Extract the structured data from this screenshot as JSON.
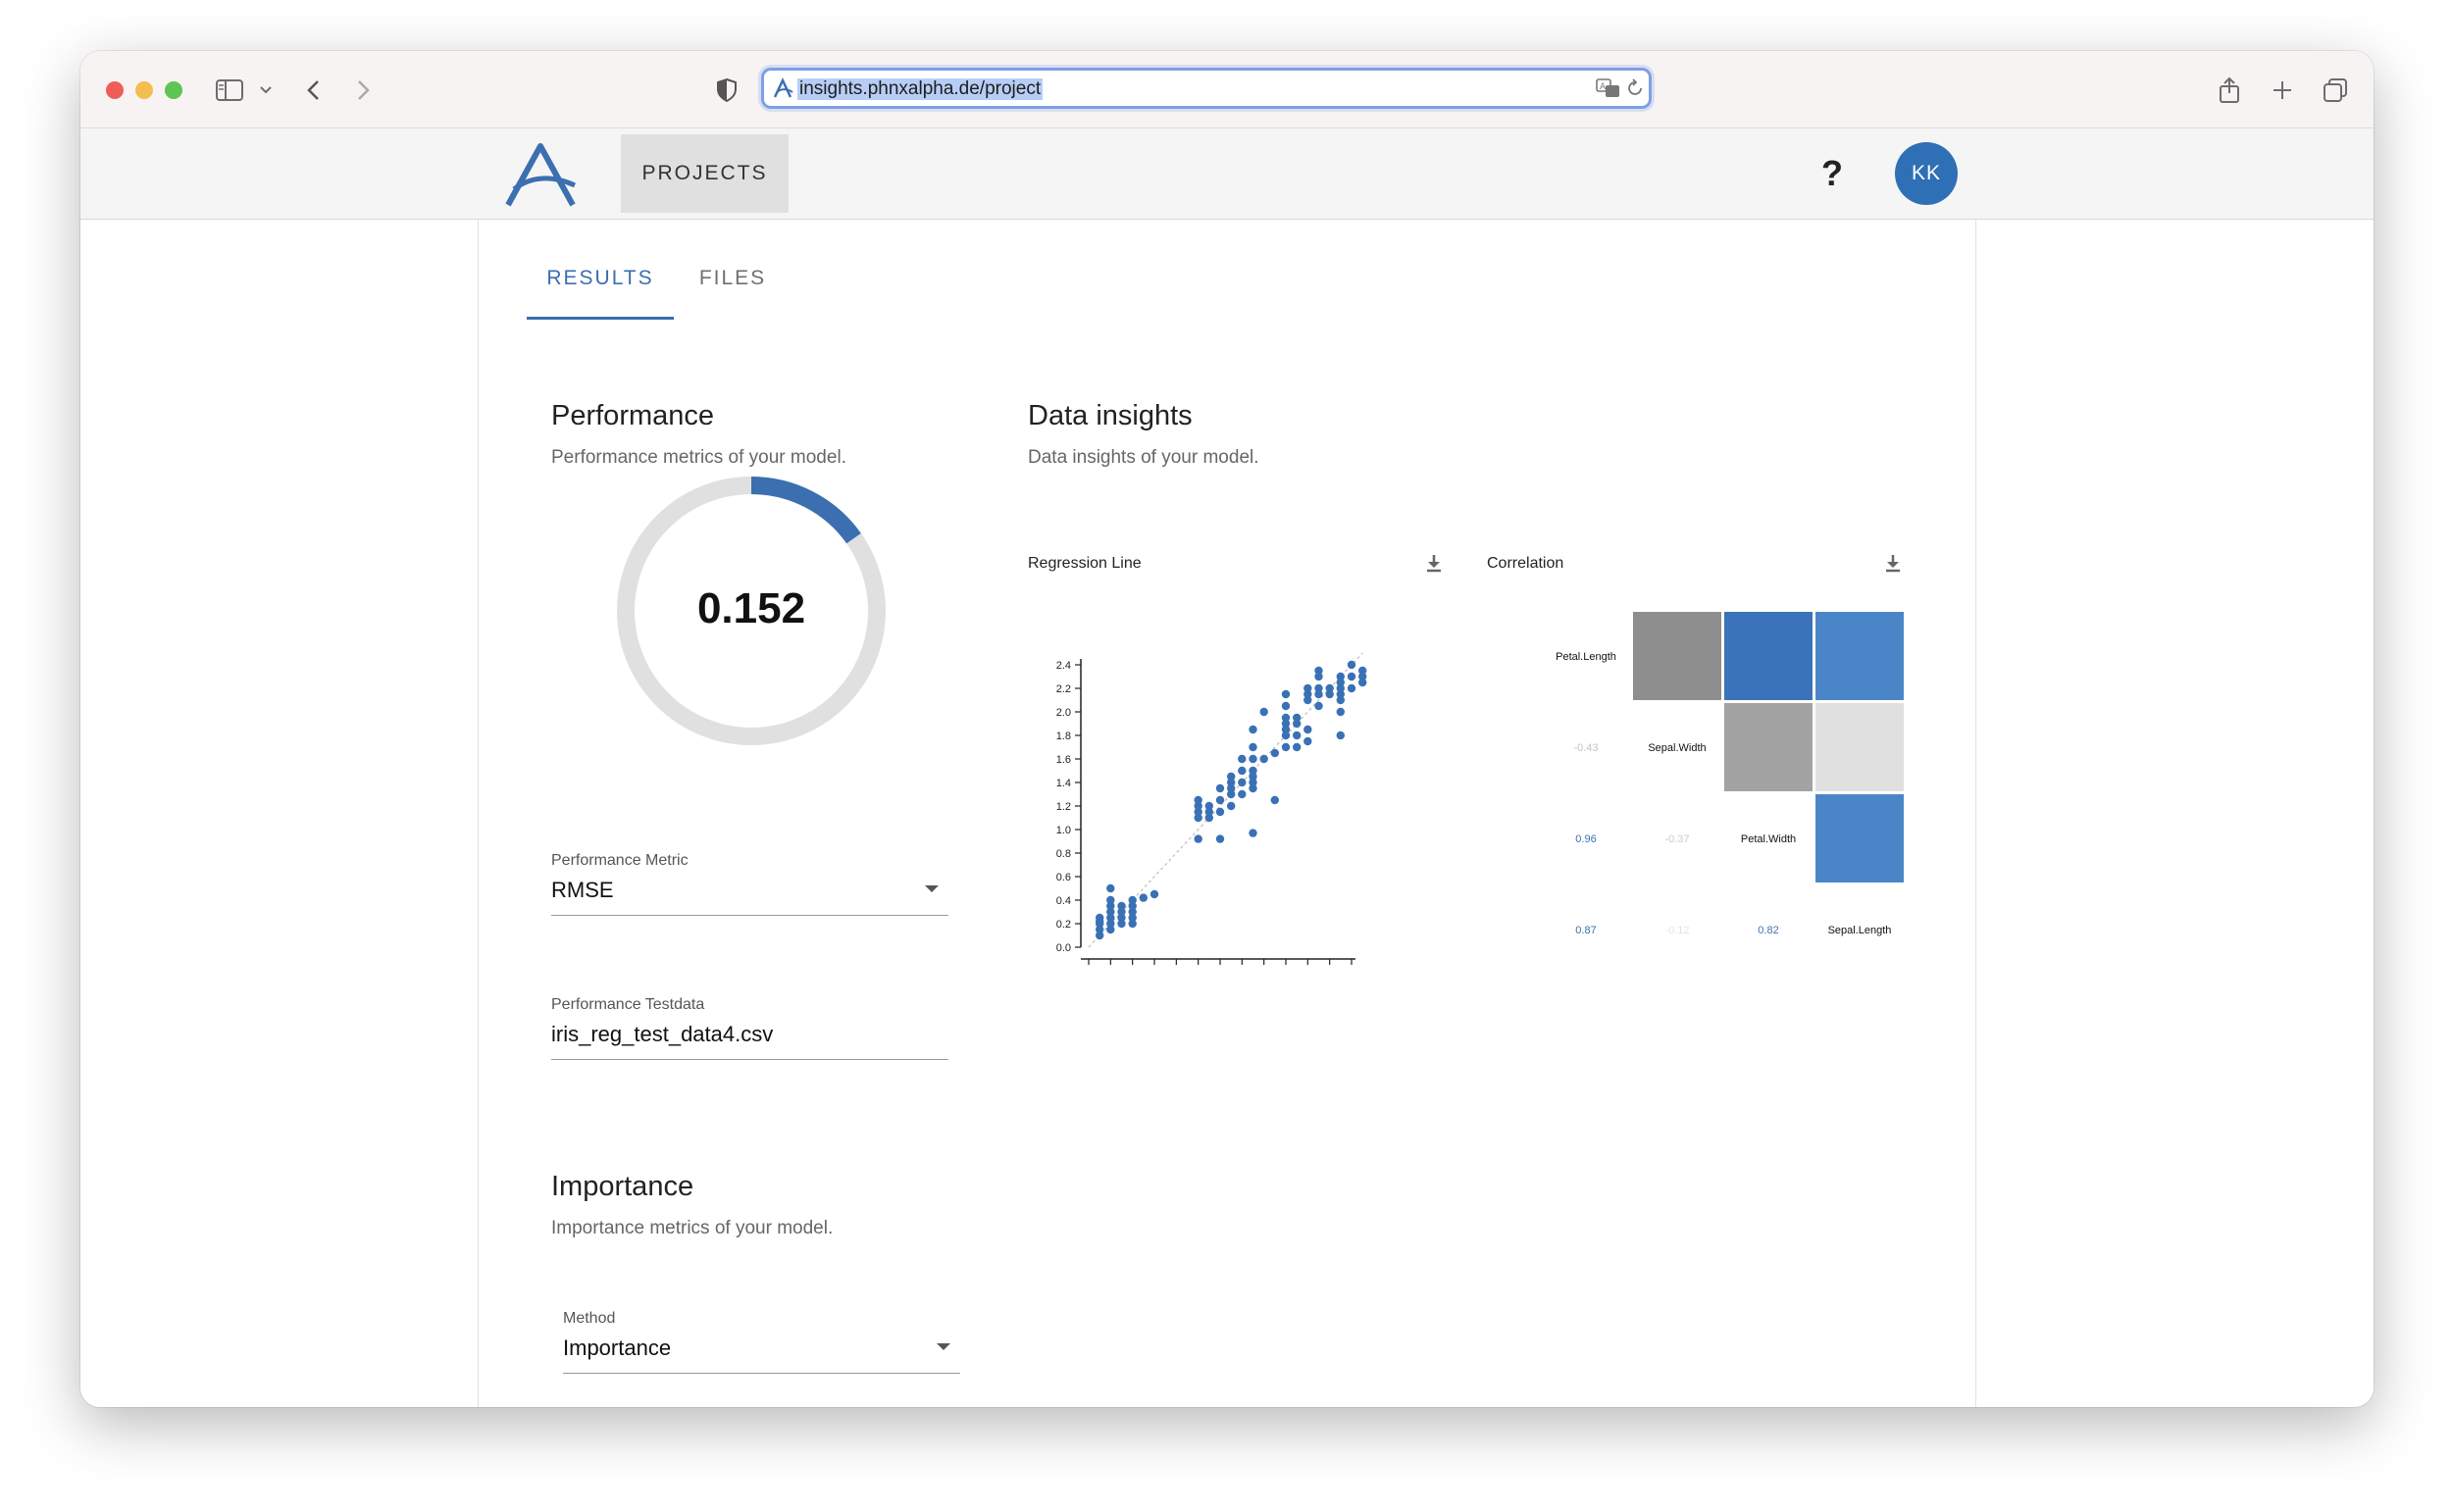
{
  "browser": {
    "url": "insights.phnxalpha.de/project"
  },
  "appbar": {
    "projects_label": "PROJECTS",
    "help_label": "?",
    "avatar_initials": "KK"
  },
  "tabs": [
    {
      "label": "RESULTS",
      "active": true
    },
    {
      "label": "FILES",
      "active": false
    }
  ],
  "performance": {
    "title": "Performance",
    "subtitle": "Performance metrics of your model.",
    "value": "0.152",
    "gauge_fraction": 0.152,
    "metric_label": "Performance Metric",
    "metric_value": "RMSE",
    "testdata_label": "Performance Testdata",
    "testdata_value": "iris_reg_test_data4.csv"
  },
  "importance": {
    "title": "Importance",
    "subtitle": "Importance metrics of your model.",
    "method_label": "Method",
    "method_value": "Importance"
  },
  "insights": {
    "title": "Data insights",
    "subtitle": "Data insights of your model.",
    "regression_title": "Regression Line",
    "correlation_title": "Correlation"
  },
  "colors": {
    "accent": "#3b6fb0",
    "point": "#3a71b5",
    "gauge_track": "#e0e0e0"
  },
  "chart_data": [
    {
      "type": "scatter",
      "title": "Regression Line",
      "xlim": [
        0,
        2.5
      ],
      "ylim": [
        0,
        2.4
      ],
      "ticks": [
        "0.0",
        "0.2",
        "0.4",
        "0.6",
        "0.8",
        "1.0",
        "1.2",
        "1.4",
        "1.6",
        "1.8",
        "2.0",
        "2.2",
        "2.4"
      ],
      "points": [
        [
          0.1,
          0.1
        ],
        [
          0.1,
          0.15
        ],
        [
          0.1,
          0.2
        ],
        [
          0.1,
          0.22
        ],
        [
          0.1,
          0.25
        ],
        [
          0.2,
          0.15
        ],
        [
          0.2,
          0.2
        ],
        [
          0.2,
          0.25
        ],
        [
          0.2,
          0.3
        ],
        [
          0.2,
          0.35
        ],
        [
          0.2,
          0.4
        ],
        [
          0.2,
          0.5
        ],
        [
          0.3,
          0.2
        ],
        [
          0.3,
          0.25
        ],
        [
          0.3,
          0.3
        ],
        [
          0.3,
          0.35
        ],
        [
          0.4,
          0.2
        ],
        [
          0.4,
          0.25
        ],
        [
          0.4,
          0.3
        ],
        [
          0.4,
          0.35
        ],
        [
          0.4,
          0.4
        ],
        [
          0.5,
          0.42
        ],
        [
          0.6,
          0.45
        ],
        [
          1.0,
          0.92
        ],
        [
          1.0,
          1.1
        ],
        [
          1.0,
          1.15
        ],
        [
          1.0,
          1.2
        ],
        [
          1.0,
          1.25
        ],
        [
          1.1,
          1.1
        ],
        [
          1.1,
          1.15
        ],
        [
          1.1,
          1.2
        ],
        [
          1.2,
          0.92
        ],
        [
          1.2,
          1.15
        ],
        [
          1.2,
          1.25
        ],
        [
          1.2,
          1.35
        ],
        [
          1.3,
          1.2
        ],
        [
          1.3,
          1.3
        ],
        [
          1.3,
          1.35
        ],
        [
          1.3,
          1.4
        ],
        [
          1.3,
          1.45
        ],
        [
          1.4,
          1.3
        ],
        [
          1.4,
          1.4
        ],
        [
          1.4,
          1.5
        ],
        [
          1.4,
          1.6
        ],
        [
          1.5,
          0.97
        ],
        [
          1.5,
          1.35
        ],
        [
          1.5,
          1.4
        ],
        [
          1.5,
          1.45
        ],
        [
          1.5,
          1.5
        ],
        [
          1.5,
          1.6
        ],
        [
          1.5,
          1.7
        ],
        [
          1.5,
          1.85
        ],
        [
          1.6,
          1.6
        ],
        [
          1.6,
          2.0
        ],
        [
          1.7,
          1.25
        ],
        [
          1.7,
          1.65
        ],
        [
          1.8,
          1.7
        ],
        [
          1.8,
          1.8
        ],
        [
          1.8,
          1.85
        ],
        [
          1.8,
          1.9
        ],
        [
          1.8,
          1.95
        ],
        [
          1.8,
          2.05
        ],
        [
          1.8,
          2.15
        ],
        [
          1.9,
          1.7
        ],
        [
          1.9,
          1.8
        ],
        [
          1.9,
          1.9
        ],
        [
          1.9,
          1.95
        ],
        [
          2.0,
          1.75
        ],
        [
          2.0,
          1.85
        ],
        [
          2.0,
          2.1
        ],
        [
          2.0,
          2.15
        ],
        [
          2.0,
          2.2
        ],
        [
          2.1,
          2.05
        ],
        [
          2.1,
          2.15
        ],
        [
          2.1,
          2.2
        ],
        [
          2.1,
          2.3
        ],
        [
          2.1,
          2.35
        ],
        [
          2.2,
          2.15
        ],
        [
          2.2,
          2.2
        ],
        [
          2.3,
          1.8
        ],
        [
          2.3,
          2.0
        ],
        [
          2.3,
          2.1
        ],
        [
          2.3,
          2.15
        ],
        [
          2.3,
          2.2
        ],
        [
          2.3,
          2.25
        ],
        [
          2.3,
          2.3
        ],
        [
          2.4,
          2.2
        ],
        [
          2.4,
          2.3
        ],
        [
          2.4,
          2.4
        ],
        [
          2.5,
          2.25
        ],
        [
          2.5,
          2.3
        ],
        [
          2.5,
          2.35
        ]
      ],
      "regression_line": [
        [
          0,
          0
        ],
        [
          2.5,
          2.5
        ]
      ]
    },
    {
      "type": "heatmap",
      "title": "Correlation",
      "variables": [
        "Petal.Length",
        "Sepal.Width",
        "Petal.Width",
        "Sepal.Length"
      ],
      "lower_labels": [
        {
          "row": 1,
          "col": 0,
          "text": "-0.43"
        },
        {
          "row": 2,
          "col": 0,
          "text": "0.96"
        },
        {
          "row": 2,
          "col": 1,
          "text": "-0.37"
        },
        {
          "row": 3,
          "col": 0,
          "text": "0.87"
        },
        {
          "row": 3,
          "col": 1,
          "text": "-0.12"
        },
        {
          "row": 3,
          "col": 2,
          "text": "0.82"
        }
      ],
      "upper_cells": [
        {
          "row": 0,
          "col": 1,
          "color": "#8e8e8e"
        },
        {
          "row": 0,
          "col": 2,
          "color": "#3a73b9"
        },
        {
          "row": 0,
          "col": 3,
          "color": "#4a86c7"
        },
        {
          "row": 1,
          "col": 2,
          "color": "#a3a3a3"
        },
        {
          "row": 1,
          "col": 3,
          "color": "#e0e0e0"
        },
        {
          "row": 2,
          "col": 3,
          "color": "#4a86c7"
        }
      ]
    }
  ]
}
